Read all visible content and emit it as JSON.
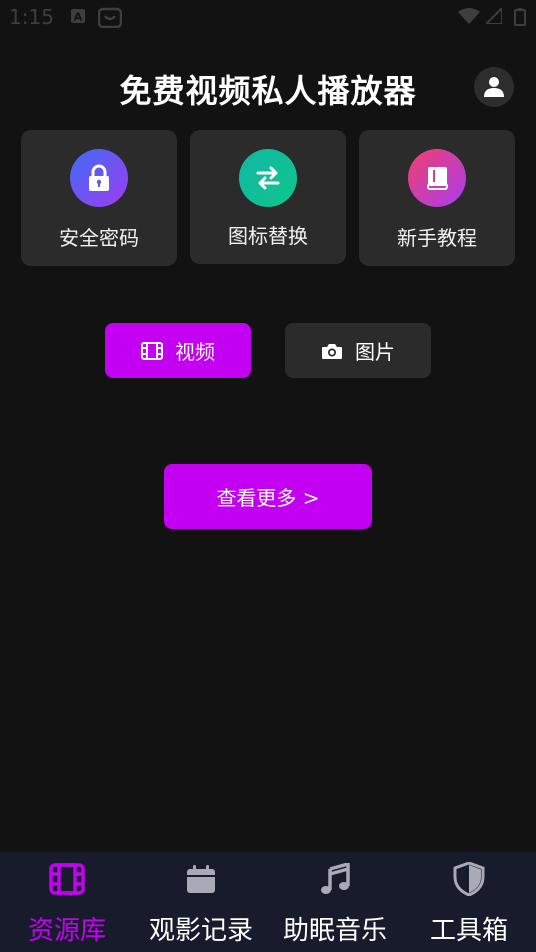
{
  "status_bar": {
    "time": "1:15"
  },
  "header": {
    "title": "免费视频私人播放器"
  },
  "features": [
    {
      "label": "安全密码",
      "icon": "lock-icon",
      "gradient": [
        "#3c6cf5",
        "#a03cf0"
      ]
    },
    {
      "label": "图标替换",
      "icon": "swap-icon",
      "gradient": [
        "#0fb8a6",
        "#12c48b"
      ]
    },
    {
      "label": "新手教程",
      "icon": "book-icon",
      "gradient": [
        "#f0406e",
        "#a83cf0"
      ]
    }
  ],
  "media_toggle": {
    "video_label": "视频",
    "photo_label": "图片",
    "selected": "视频"
  },
  "more_button": {
    "label": "查看更多 >"
  },
  "bottom_nav": {
    "items": [
      {
        "label": "资源库",
        "icon": "film-icon",
        "active": true
      },
      {
        "label": "观影记录",
        "icon": "calendar-icon",
        "active": false
      },
      {
        "label": "助眠音乐",
        "icon": "music-note-icon",
        "active": false
      },
      {
        "label": "工具箱",
        "icon": "shield-icon",
        "active": false
      }
    ]
  },
  "colors": {
    "accent": "#c400f2",
    "background": "#121212",
    "card": "#2b2b2b",
    "nav_bg": "#171b2b"
  }
}
